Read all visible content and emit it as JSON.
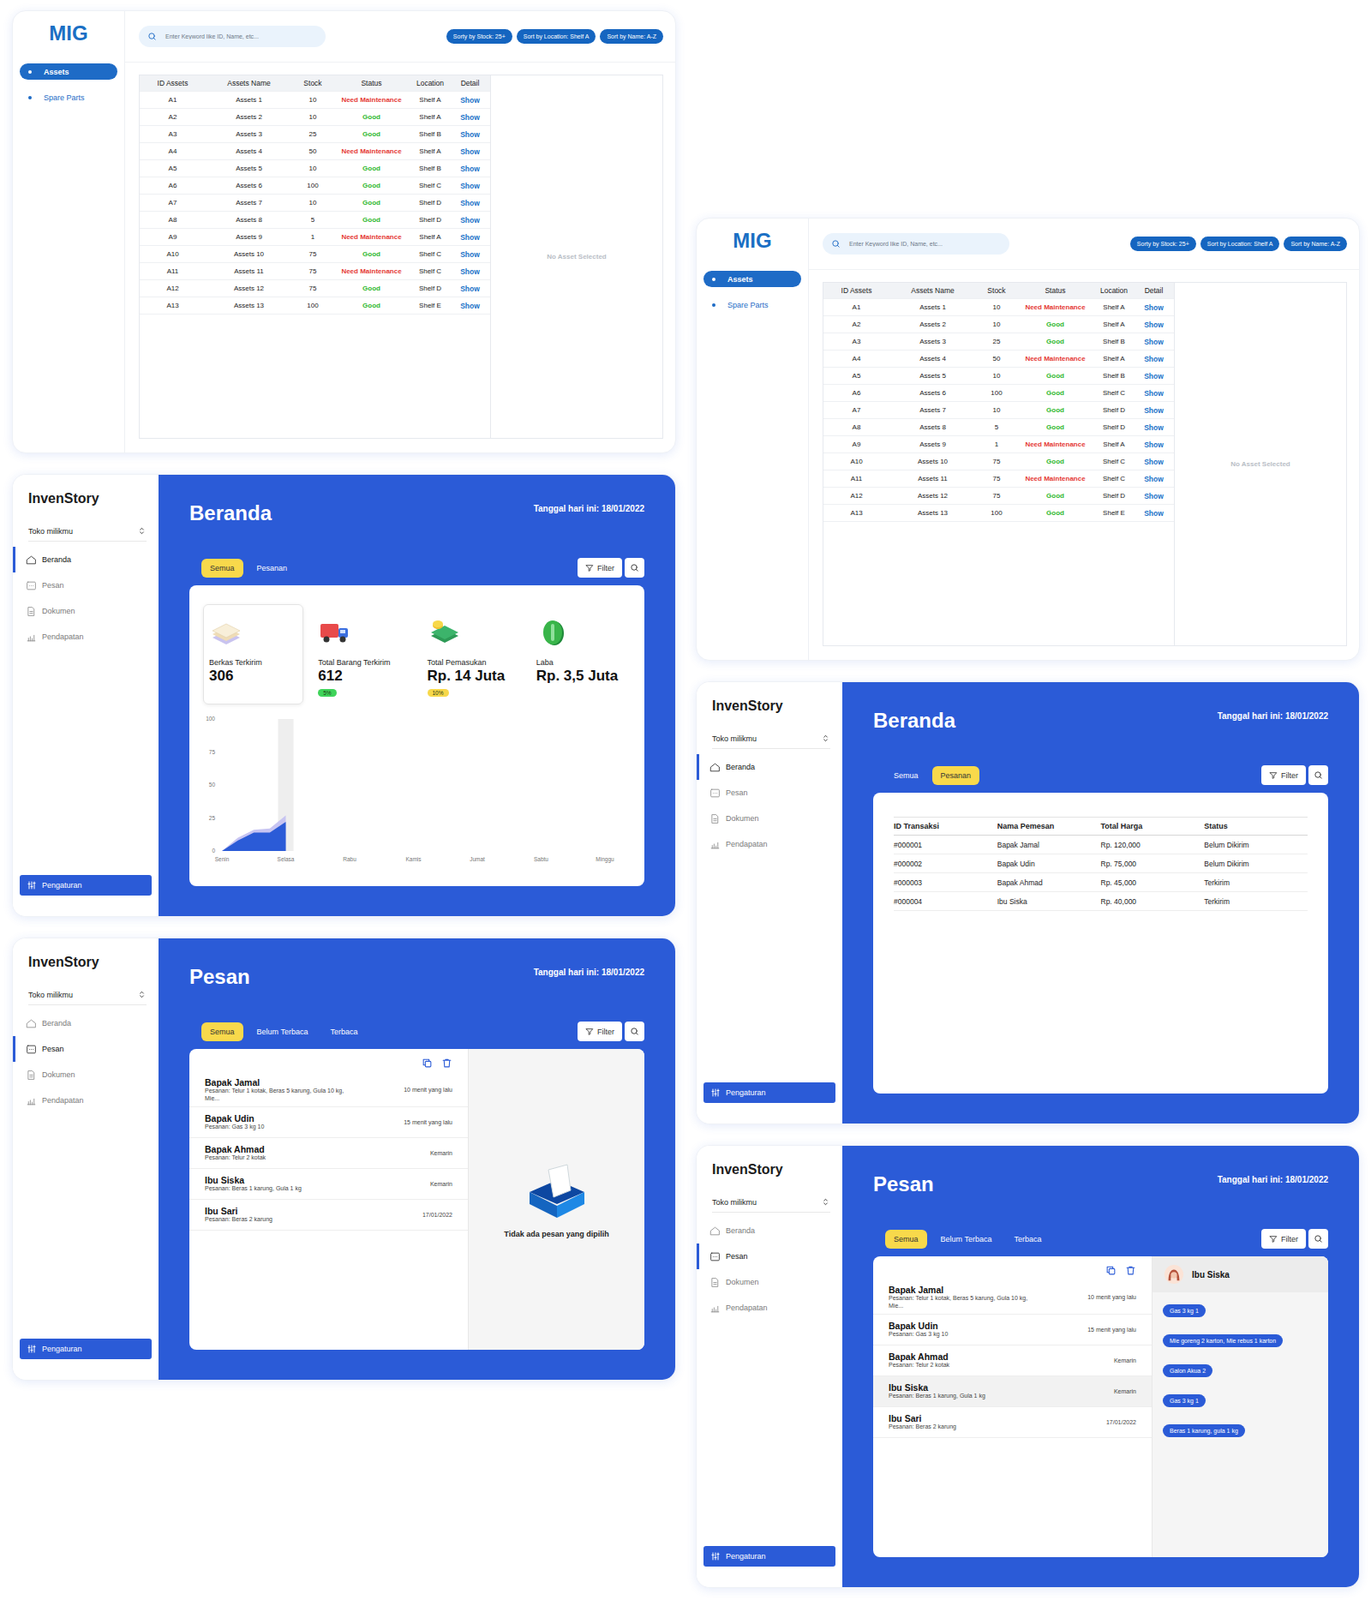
{
  "boards": [
    {
      "screens": [
        {
          "kind": "assets",
          "logo": "MIG",
          "nav": [
            {
              "label": "Assets",
              "selected": true
            },
            {
              "label": "Spare Parts",
              "selected": false
            }
          ],
          "search": {
            "placeholder": "Enter Keyword like ID, Name, etc..."
          },
          "sort_buttons": [
            "Sorty by Stock: 25+",
            "Sort by Location: Shelf A",
            "Sort by Name: A-Z"
          ],
          "table": {
            "columns": [
              "ID Assets",
              "Assets Name",
              "Stock",
              "Status",
              "Location",
              "Detail"
            ],
            "rows": [
              {
                "id": "A1",
                "name": "Assets 1",
                "stock": "10",
                "status": "Need Maintenance",
                "color": "#e53935",
                "location": "Shelf A",
                "detail": "Show"
              },
              {
                "id": "A2",
                "name": "Assets 2",
                "stock": "10",
                "status": "Good",
                "color": "#2eb82e",
                "location": "Shelf A",
                "detail": "Show"
              },
              {
                "id": "A3",
                "name": "Assets 3",
                "stock": "25",
                "status": "Good",
                "color": "#2eb82e",
                "location": "Shelf B",
                "detail": "Show"
              },
              {
                "id": "A4",
                "name": "Assets 4",
                "stock": "50",
                "status": "Need Maintenance",
                "color": "#e53935",
                "location": "Shelf A",
                "detail": "Show"
              },
              {
                "id": "A5",
                "name": "Assets 5",
                "stock": "10",
                "status": "Good",
                "color": "#2eb82e",
                "location": "Shelf B",
                "detail": "Show"
              },
              {
                "id": "A6",
                "name": "Assets 6",
                "stock": "100",
                "status": "Good",
                "color": "#2eb82e",
                "location": "Shelf C",
                "detail": "Show"
              },
              {
                "id": "A7",
                "name": "Assets 7",
                "stock": "10",
                "status": "Good",
                "color": "#2eb82e",
                "location": "Shelf D",
                "detail": "Show"
              },
              {
                "id": "A8",
                "name": "Assets 8",
                "stock": "5",
                "status": "Good",
                "color": "#2eb82e",
                "location": "Shelf D",
                "detail": "Show"
              },
              {
                "id": "A9",
                "name": "Assets 9",
                "stock": "1",
                "status": "Need Maintenance",
                "color": "#e53935",
                "location": "Shelf A",
                "detail": "Show"
              },
              {
                "id": "A10",
                "name": "Assets 10",
                "stock": "75",
                "status": "Good",
                "color": "#2eb82e",
                "location": "Shelf C",
                "detail": "Show"
              },
              {
                "id": "A11",
                "name": "Assets 11",
                "stock": "75",
                "status": "Need Maintenance",
                "color": "#e53935",
                "location": "Shelf C",
                "detail": "Show"
              },
              {
                "id": "A12",
                "name": "Assets 12",
                "stock": "75",
                "status": "Good",
                "color": "#2eb82e",
                "location": "Shelf D",
                "detail": "Show"
              },
              {
                "id": "A13",
                "name": "Assets 13",
                "stock": "100",
                "status": "Good",
                "color": "#2eb82e",
                "location": "Shelf E",
                "detail": "Show"
              }
            ]
          },
          "detail_panel": {
            "empty": "No Asset Selected"
          }
        },
        {
          "kind": "overview",
          "sidebar": {
            "brand": "InvenStory",
            "store": "Toko milikmu",
            "items": [
              {
                "label": "Beranda",
                "selected": true
              },
              {
                "label": "Pesan",
                "selected": false
              },
              {
                "label": "Dokumen",
                "selected": false
              },
              {
                "label": "Pendapatan",
                "selected": false
              }
            ],
            "settings": "Pengaturan"
          },
          "header": {
            "title": "Beranda",
            "date": "Tanggal hari ini: 18/01/2022"
          },
          "tabs": [
            {
              "label": "Semua",
              "selected": true
            },
            {
              "label": "Pesanan",
              "selected": false
            }
          ],
          "filter": "Filter",
          "stats": [
            {
              "label": "Berkas Terkirim",
              "value": "306",
              "selected": true
            },
            {
              "label": "Total Barang Terkirim",
              "value": "612",
              "selected": false,
              "badge": {
                "text": "5%",
                "color": "#3fd45a"
              }
            },
            {
              "label": "Total Pemasukan",
              "value": "Rp. 14 Juta",
              "selected": false,
              "badge": {
                "text": "10%",
                "color": "#f7d84a"
              }
            },
            {
              "label": "Laba",
              "value": "Rp. 3,5 Juta",
              "selected": false
            }
          ],
          "chart": {
            "y_ticks": [
              "100",
              "75",
              "50",
              "25",
              "0"
            ],
            "x_labels": [
              {
                "label": "Senin",
                "selected": false
              },
              {
                "label": "Selasa",
                "selected": true
              },
              {
                "label": "Rabu",
                "selected": false
              },
              {
                "label": "Kamis",
                "selected": false
              },
              {
                "label": "Jumat",
                "selected": false
              },
              {
                "label": "Sabtu",
                "selected": false
              },
              {
                "label": "Minggu",
                "selected": false
              }
            ],
            "series": [
              {
                "values": [
                  0,
                  10,
                  16,
                  17,
                  27
                ],
                "color": "#c7c4f2"
              },
              {
                "values": [
                  0,
                  8,
                  14,
                  14,
                  22
                ],
                "color": "#2b5bd7"
              }
            ]
          }
        },
        {
          "kind": "inbox",
          "sidebar": {
            "brand": "InvenStory",
            "store": "Toko milikmu",
            "items": [
              {
                "label": "Beranda",
                "selected": false
              },
              {
                "label": "Pesan",
                "selected": true
              },
              {
                "label": "Dokumen",
                "selected": false
              },
              {
                "label": "Pendapatan",
                "selected": false
              }
            ],
            "settings": "Pengaturan"
          },
          "header": {
            "title": "Pesan",
            "date": "Tanggal hari ini: 18/01/2022"
          },
          "tabs": [
            {
              "label": "Semua",
              "selected": true
            },
            {
              "label": "Belum Terbaca",
              "selected": false
            },
            {
              "label": "Terbaca",
              "selected": false
            }
          ],
          "filter": "Filter",
          "messages": [
            {
              "name": "Bapak Jamal",
              "preview": "Pesanan: Telur 1 kotak, Beras 5 karung, Gula 10 kg, Mie...",
              "time": "10 menit yang lalu",
              "selected": false
            },
            {
              "name": "Bapak Udin",
              "preview": "Pesanan: Gas 3 kg 10",
              "time": "15 menit yang lalu",
              "selected": false
            },
            {
              "name": "Bapak Ahmad",
              "preview": "Pesanan: Telur 2 kotak",
              "time": "Kemarin",
              "selected": false
            },
            {
              "name": "Ibu Siska",
              "preview": "Pesanan: Beras 1 karung, Gula 1 kg",
              "time": "Kemarin",
              "selected": false
            },
            {
              "name": "Ibu Sari",
              "preview": "Pesanan: Beras 2 karung",
              "time": "17/01/2022",
              "selected": false
            }
          ],
          "detail": {
            "kind": "empty",
            "text": "Tidak ada pesan yang dipilih"
          }
        }
      ]
    },
    {
      "screens": [
        {
          "kind": "assets",
          "logo": "MIG",
          "nav": [
            {
              "label": "Assets",
              "selected": true
            },
            {
              "label": "Spare Parts",
              "selected": false
            }
          ],
          "search": {
            "placeholder": "Enter Keyword like ID, Name, etc..."
          },
          "sort_buttons": [
            "Sorty by Stock: 25+",
            "Sort by Location: Shelf A",
            "Sort by Name: A-Z"
          ],
          "table": {
            "columns": [
              "ID Assets",
              "Assets Name",
              "Stock",
              "Status",
              "Location",
              "Detail"
            ],
            "rows": [
              {
                "id": "A1",
                "name": "Assets 1",
                "stock": "10",
                "status": "Need Maintenance",
                "color": "#e53935",
                "location": "Shelf A",
                "detail": "Show"
              },
              {
                "id": "A2",
                "name": "Assets 2",
                "stock": "10",
                "status": "Good",
                "color": "#2eb82e",
                "location": "Shelf A",
                "detail": "Show"
              },
              {
                "id": "A3",
                "name": "Assets 3",
                "stock": "25",
                "status": "Good",
                "color": "#2eb82e",
                "location": "Shelf B",
                "detail": "Show"
              },
              {
                "id": "A4",
                "name": "Assets 4",
                "stock": "50",
                "status": "Need Maintenance",
                "color": "#e53935",
                "location": "Shelf A",
                "detail": "Show"
              },
              {
                "id": "A5",
                "name": "Assets 5",
                "stock": "10",
                "status": "Good",
                "color": "#2eb82e",
                "location": "Shelf B",
                "detail": "Show"
              },
              {
                "id": "A6",
                "name": "Assets 6",
                "stock": "100",
                "status": "Good",
                "color": "#2eb82e",
                "location": "Shelf C",
                "detail": "Show"
              },
              {
                "id": "A7",
                "name": "Assets 7",
                "stock": "10",
                "status": "Good",
                "color": "#2eb82e",
                "location": "Shelf D",
                "detail": "Show"
              },
              {
                "id": "A8",
                "name": "Assets 8",
                "stock": "5",
                "status": "Good",
                "color": "#2eb82e",
                "location": "Shelf D",
                "detail": "Show"
              },
              {
                "id": "A9",
                "name": "Assets 9",
                "stock": "1",
                "status": "Need Maintenance",
                "color": "#e53935",
                "location": "Shelf A",
                "detail": "Show"
              },
              {
                "id": "A10",
                "name": "Assets 10",
                "stock": "75",
                "status": "Good",
                "color": "#2eb82e",
                "location": "Shelf C",
                "detail": "Show"
              },
              {
                "id": "A11",
                "name": "Assets 11",
                "stock": "75",
                "status": "Need Maintenance",
                "color": "#e53935",
                "location": "Shelf C",
                "detail": "Show"
              },
              {
                "id": "A12",
                "name": "Assets 12",
                "stock": "75",
                "status": "Good",
                "color": "#2eb82e",
                "location": "Shelf D",
                "detail": "Show"
              },
              {
                "id": "A13",
                "name": "Assets 13",
                "stock": "100",
                "status": "Good",
                "color": "#2eb82e",
                "location": "Shelf E",
                "detail": "Show"
              }
            ]
          },
          "detail_panel": {
            "empty": "No Asset Selected"
          }
        },
        {
          "kind": "orders",
          "sidebar": {
            "brand": "InvenStory",
            "store": "Toko milikmu",
            "items": [
              {
                "label": "Beranda",
                "selected": true
              },
              {
                "label": "Pesan",
                "selected": false
              },
              {
                "label": "Dokumen",
                "selected": false
              },
              {
                "label": "Pendapatan",
                "selected": false
              }
            ],
            "settings": "Pengaturan"
          },
          "header": {
            "title": "Beranda",
            "date": "Tanggal hari ini: 18/01/2022"
          },
          "tabs": [
            {
              "label": "Semua",
              "selected": false
            },
            {
              "label": "Pesanan",
              "selected": true
            }
          ],
          "filter": "Filter",
          "table": {
            "columns": [
              "ID Transaksi",
              "Nama Pemesan",
              "Total Harga",
              "Status"
            ],
            "rows": [
              {
                "id": "#000001",
                "customer": "Bapak Jamal",
                "total": "Rp. 120,000",
                "status": "Belum Dikirim"
              },
              {
                "id": "#000002",
                "customer": "Bapak Udin",
                "total": "Rp. 75,000",
                "status": "Belum Dikirim"
              },
              {
                "id": "#000003",
                "customer": "Bapak Ahmad",
                "total": "Rp. 45,000",
                "status": "Terkirim"
              },
              {
                "id": "#000004",
                "customer": "Ibu Siska",
                "total": "Rp. 40,000",
                "status": "Terkirim"
              }
            ]
          }
        },
        {
          "kind": "inbox",
          "sidebar": {
            "brand": "InvenStory",
            "store": "Toko milikmu",
            "items": [
              {
                "label": "Beranda",
                "selected": false
              },
              {
                "label": "Pesan",
                "selected": true
              },
              {
                "label": "Dokumen",
                "selected": false
              },
              {
                "label": "Pendapatan",
                "selected": false
              }
            ],
            "settings": "Pengaturan"
          },
          "header": {
            "title": "Pesan",
            "date": "Tanggal hari ini: 18/01/2022"
          },
          "tabs": [
            {
              "label": "Semua",
              "selected": true
            },
            {
              "label": "Belum Terbaca",
              "selected": false
            },
            {
              "label": "Terbaca",
              "selected": false
            }
          ],
          "filter": "Filter",
          "messages": [
            {
              "name": "Bapak Jamal",
              "preview": "Pesanan: Telur 1 kotak, Beras 5 karung, Gula 10 kg, Mie...",
              "time": "10 menit yang lalu",
              "selected": false
            },
            {
              "name": "Bapak Udin",
              "preview": "Pesanan: Gas 3 kg 10",
              "time": "15 menit yang lalu",
              "selected": false
            },
            {
              "name": "Bapak Ahmad",
              "preview": "Pesanan: Telur 2 kotak",
              "time": "Kemarin",
              "selected": false
            },
            {
              "name": "Ibu Siska",
              "preview": "Pesanan: Beras 1 karung, Gula 1 kg",
              "time": "Kemarin",
              "selected": true
            },
            {
              "name": "Ibu Sari",
              "preview": "Pesanan: Beras 2 karung",
              "time": "17/01/2022",
              "selected": false
            }
          ],
          "detail": {
            "kind": "chat",
            "name": "Ibu Siska",
            "bubbles": [
              "Gas 3 kg 1",
              "Mie goreng 2 karton, Mie rebus 1 karton",
              "Galon Akua 2",
              "Gas 3 kg 1",
              "Beras 1 karung, gula 1 kg"
            ]
          }
        }
      ]
    }
  ]
}
